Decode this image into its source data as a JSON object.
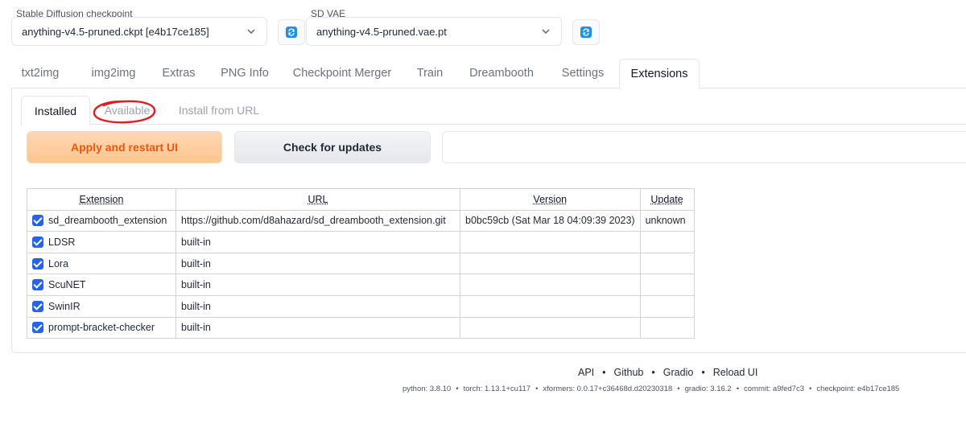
{
  "checkpoint": {
    "label": "Stable Diffusion checkpoint",
    "value": "anything-v4.5-pruned.ckpt [e4b17ce185]"
  },
  "vae": {
    "label": "SD VAE",
    "value": "anything-v4.5-pruned.vae.pt"
  },
  "main_tabs": [
    {
      "label": "txt2img"
    },
    {
      "label": "img2img"
    },
    {
      "label": "Extras"
    },
    {
      "label": "PNG Info"
    },
    {
      "label": "Checkpoint Merger"
    },
    {
      "label": "Train"
    },
    {
      "label": "Dreambooth"
    },
    {
      "label": "Settings"
    },
    {
      "label": "Extensions"
    }
  ],
  "sub_tabs": [
    {
      "label": "Installed"
    },
    {
      "label": "Available"
    },
    {
      "label": "Install from URL"
    }
  ],
  "buttons": {
    "apply": "Apply and restart UI",
    "check": "Check for updates"
  },
  "table": {
    "headers": [
      "Extension",
      "URL",
      "Version",
      "Update"
    ],
    "rows": [
      {
        "name": "sd_dreambooth_extension",
        "url": "https://github.com/d8ahazard/sd_dreambooth_extension.git",
        "version": "b0bc59cb (Sat Mar 18 04:09:39 2023)",
        "update": "unknown"
      },
      {
        "name": "LDSR",
        "url": "built-in",
        "version": "",
        "update": ""
      },
      {
        "name": "Lora",
        "url": "built-in",
        "version": "",
        "update": ""
      },
      {
        "name": "ScuNET",
        "url": "built-in",
        "version": "",
        "update": ""
      },
      {
        "name": "SwinIR",
        "url": "built-in",
        "version": "",
        "update": ""
      },
      {
        "name": "prompt-bracket-checker",
        "url": "built-in",
        "version": "",
        "update": ""
      }
    ]
  },
  "footer": {
    "links": [
      "API",
      "Github",
      "Gradio",
      "Reload UI"
    ],
    "info": [
      "python: 3.8.10",
      "torch: 1.13.1+cu117",
      "xformers: 0.0.17+c36468d.d20230318",
      "gradio: 3.16.2",
      "commit: a9fed7c3",
      "checkpoint: e4b17ce185"
    ]
  },
  "colors": {
    "accent": "#ea580c",
    "checkbox": "#2563eb",
    "refresh": "#1e90e8",
    "annotation": "#e11d1d"
  }
}
